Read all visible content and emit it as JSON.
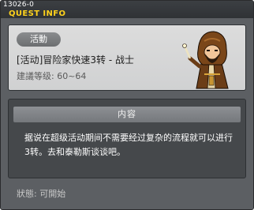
{
  "window": {
    "quest_id": "13026-0",
    "title": "QUEST INFO"
  },
  "quest": {
    "category_label": "活動",
    "name": "[活动]冒险家快速3转 - 战士",
    "level_label": "建議等级:",
    "level_range": "60~64",
    "npc_icon": "hooded-npc-portrait"
  },
  "content": {
    "header": "内容",
    "description": "据说在超级活动期间不需要经过复杂的流程就可以进行3转。去和泰勒斯谈谈吧。"
  },
  "status": {
    "label": "狀態:",
    "value": "可開始"
  },
  "colors": {
    "title": "#ffd21c",
    "frame": "#5c5f63",
    "panel": "#d6d7d8"
  }
}
